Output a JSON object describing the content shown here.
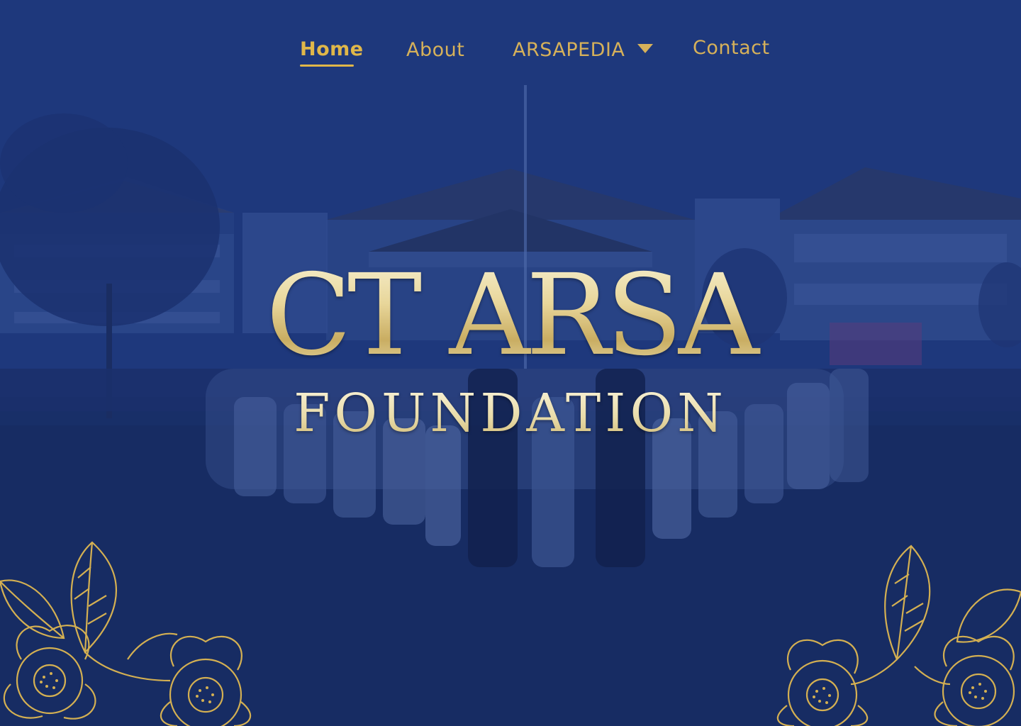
{
  "nav": {
    "items": [
      {
        "label": "Home",
        "active": true
      },
      {
        "label": "About"
      },
      {
        "label": "ARSAPEDIA",
        "has_dropdown": true
      },
      {
        "label": "Contact"
      }
    ]
  },
  "hero": {
    "logo_line1": "CT ARSA",
    "logo_line2": "FOUNDATION"
  },
  "colors": {
    "overlay": "#1c3376",
    "nav_text": "#d6b15a",
    "gold": "#d4b052"
  },
  "icons": {
    "dropdown": "caret-down-icon",
    "decoration": "floral-ornament"
  }
}
